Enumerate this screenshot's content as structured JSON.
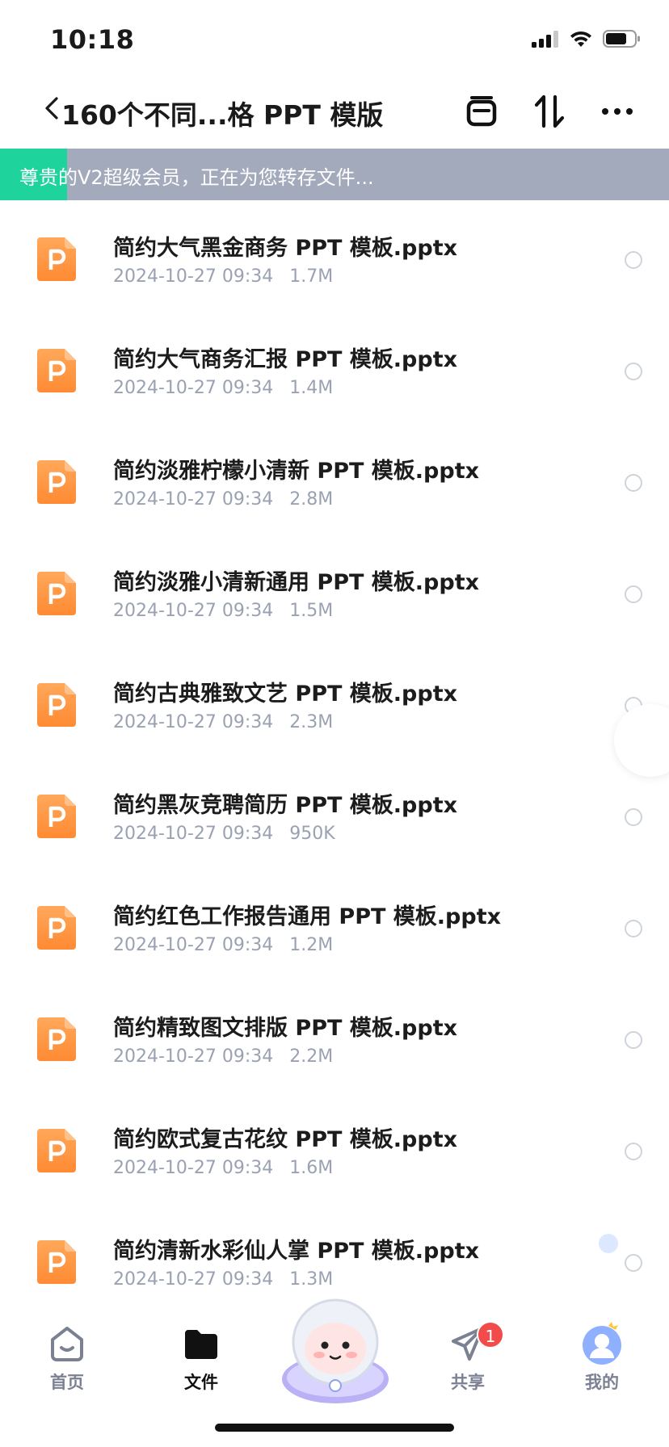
{
  "status": {
    "time": "10:18"
  },
  "header": {
    "title": "160个不同...格 PPT 模版"
  },
  "banner": {
    "text": "尊贵的V2超级会员，正在为您转存文件...",
    "progress": 0.1
  },
  "files": [
    {
      "name": "简约大气黑金商务 PPT 模板.pptx",
      "date": "2024-10-27 09:34",
      "size": "1.7M"
    },
    {
      "name": "简约大气商务汇报 PPT 模板.pptx",
      "date": "2024-10-27 09:34",
      "size": "1.4M"
    },
    {
      "name": "简约淡雅柠檬小清新 PPT 模板.pptx",
      "date": "2024-10-27 09:34",
      "size": "2.8M"
    },
    {
      "name": "简约淡雅小清新通用 PPT 模板.pptx",
      "date": "2024-10-27 09:34",
      "size": "1.5M"
    },
    {
      "name": "简约古典雅致文艺 PPT 模板.pptx",
      "date": "2024-10-27 09:34",
      "size": "2.3M"
    },
    {
      "name": "简约黑灰竞聘简历 PPT 模板.pptx",
      "date": "2024-10-27 09:34",
      "size": "950K"
    },
    {
      "name": "简约红色工作报告通用 PPT 模板.pptx",
      "date": "2024-10-27 09:34",
      "size": "1.2M"
    },
    {
      "name": "简约精致图文排版 PPT 模板.pptx",
      "date": "2024-10-27 09:34",
      "size": "2.2M"
    },
    {
      "name": "简约欧式复古花纹 PPT 模板.pptx",
      "date": "2024-10-27 09:34",
      "size": "1.6M"
    },
    {
      "name": "简约清新水彩仙人掌 PPT 模板.pptx",
      "date": "2024-10-27 09:34",
      "size": "1.3M"
    }
  ],
  "tabs": {
    "home": "首页",
    "files": "文件",
    "share": "共享",
    "share_badge": "1",
    "mine": "我的"
  },
  "colors": {
    "accent_green": "#1ed49c",
    "file_icon_orange": "#ff8c3a",
    "badge_red": "#f24b4b"
  },
  "icons": [
    "back-icon",
    "clip-icon",
    "sort-icon",
    "more-icon",
    "ppt-file-icon",
    "home-icon",
    "folder-icon",
    "send-icon",
    "avatar-icon"
  ]
}
